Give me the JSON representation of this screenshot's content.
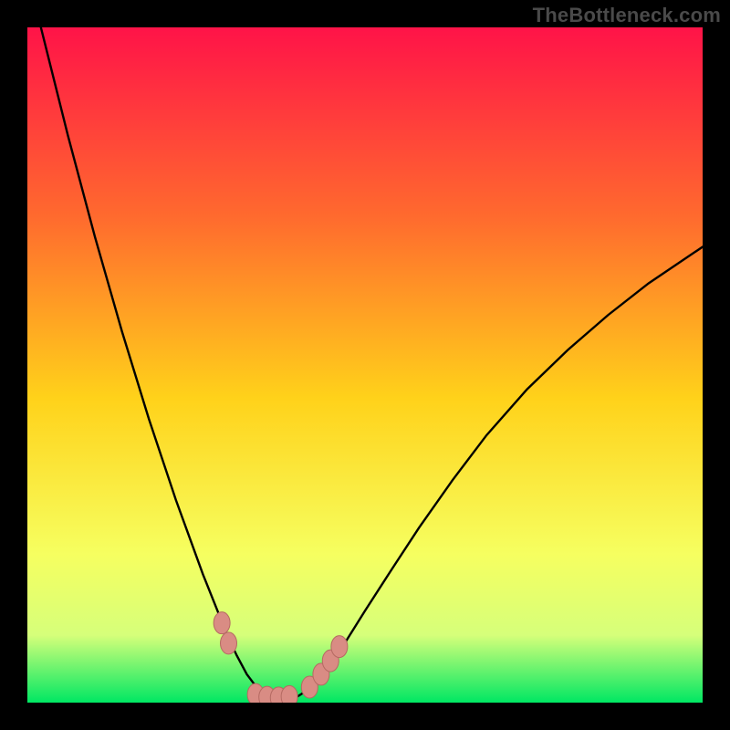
{
  "watermark": "TheBottleneck.com",
  "colors": {
    "frame": "#000000",
    "gradient_top": "#ff1348",
    "gradient_mid_upper": "#ff6a2e",
    "gradient_mid": "#ffd21a",
    "gradient_mid_lower": "#f6ff60",
    "gradient_lower": "#d6ff7a",
    "gradient_bottom": "#00e763",
    "curve": "#000000",
    "marker_fill": "#d98c84",
    "marker_stroke": "#b56a62"
  },
  "chart_data": {
    "type": "line",
    "title": "",
    "xlabel": "",
    "ylabel": "",
    "xlim": [
      0,
      100
    ],
    "ylim": [
      0,
      100
    ],
    "series": [
      {
        "name": "bottleneck-curve",
        "x": [
          0,
          2,
          4,
          6,
          8,
          10,
          12,
          14,
          16,
          18,
          20,
          22,
          24,
          26,
          28,
          29.5,
          31,
          32.5,
          34,
          35.5,
          37,
          38.5,
          40,
          42,
          44,
          47,
          50,
          54,
          58,
          63,
          68,
          74,
          80,
          86,
          92,
          100
        ],
        "y": [
          108,
          100,
          92,
          84,
          76.5,
          69,
          62,
          55,
          48.5,
          42,
          36,
          30,
          24.5,
          19,
          14,
          10.2,
          7,
          4.2,
          2.2,
          1.0,
          0.4,
          0.4,
          0.9,
          2.2,
          4.6,
          8.8,
          13.6,
          19.8,
          25.9,
          33.0,
          39.6,
          46.4,
          52.2,
          57.4,
          62.1,
          67.5
        ]
      }
    ],
    "markers": [
      {
        "x": 28.8,
        "y": 11.8
      },
      {
        "x": 29.8,
        "y": 8.8
      },
      {
        "x": 33.8,
        "y": 1.2
      },
      {
        "x": 35.5,
        "y": 0.8
      },
      {
        "x": 37.2,
        "y": 0.7
      },
      {
        "x": 38.8,
        "y": 0.9
      },
      {
        "x": 41.8,
        "y": 2.3
      },
      {
        "x": 43.5,
        "y": 4.2
      },
      {
        "x": 44.9,
        "y": 6.2
      },
      {
        "x": 46.2,
        "y": 8.3
      }
    ]
  }
}
